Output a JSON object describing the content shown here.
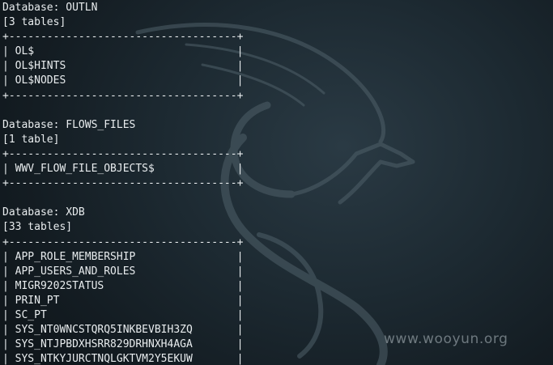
{
  "terminal_lines": [
    "Database: OUTLN",
    "[3 tables]",
    "+------------------------------------+",
    "| OL$                                |",
    "| OL$HINTS                           |",
    "| OL$NODES                           |",
    "+------------------------------------+",
    "",
    "Database: FLOWS_FILES",
    "[1 table]",
    "+------------------------------------+",
    "| WWV_FLOW_FILE_OBJECTS$             |",
    "+------------------------------------+",
    "",
    "Database: XDB",
    "[33 tables]",
    "+------------------------------------+",
    "| APP_ROLE_MEMBERSHIP                |",
    "| APP_USERS_AND_ROLES                |",
    "| MIGR9202STATUS                     |",
    "| PRIN_PT                            |",
    "| SC_PT                              |",
    "| SYS_NT0WNCSTQRQ5INKBEVBIH3ZQ       |",
    "| SYS_NTJPBDXHSRR829DRHNXH4AGA       |",
    "| SYS_NTKYJURCTNQLGKTVM2Y5EKUW       |"
  ],
  "watermark": "www.wooyun.org",
  "colors": {
    "terminal_text": "#e8ecee",
    "background": "#1d2a32",
    "dragon": "#4a5a63"
  },
  "icons": [
    "kali-dragon-wallpaper-icon"
  ]
}
